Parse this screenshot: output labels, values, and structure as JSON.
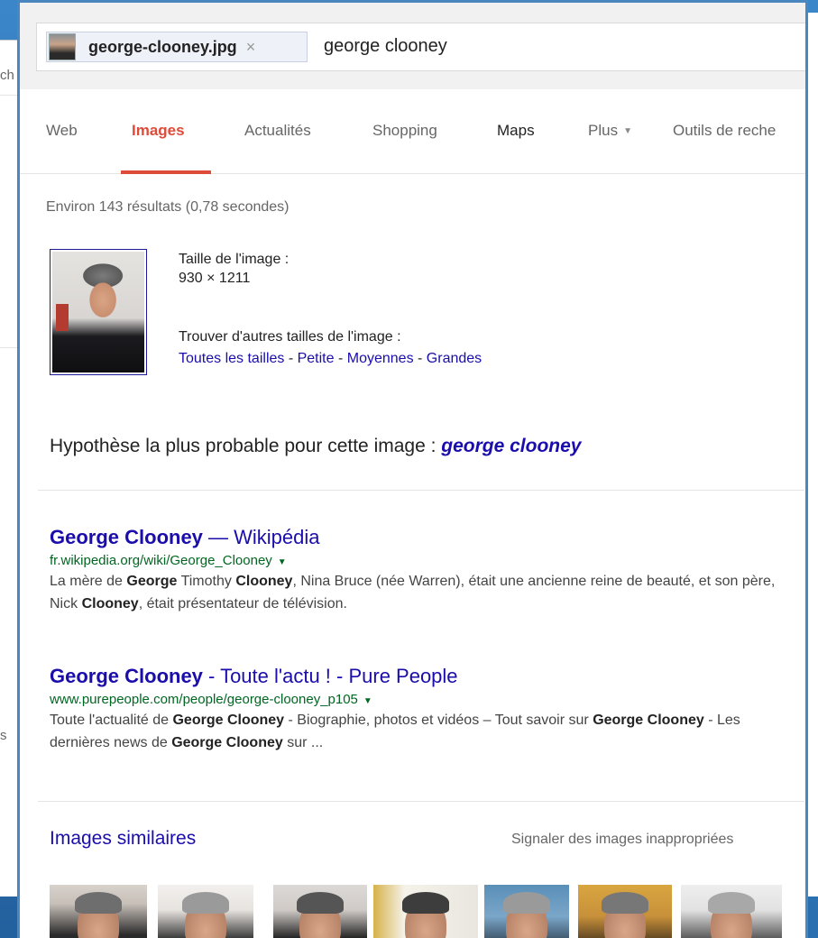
{
  "background": {
    "left_peek_top": "ch",
    "left_peek_mid": "s"
  },
  "search": {
    "chip_filename": "george-clooney.jpg",
    "chip_close": "×",
    "query": "george clooney"
  },
  "tabs": [
    {
      "label": "Web"
    },
    {
      "label": "Images"
    },
    {
      "label": "Actualités"
    },
    {
      "label": "Shopping"
    },
    {
      "label": "Maps"
    },
    {
      "label": "Plus"
    },
    {
      "label": "Outils de reche"
    }
  ],
  "stats": "Environ 143 résultats (0,78 secondes)",
  "image_info": {
    "size_label": "Taille de l'image :",
    "size_value": "930 × 1211",
    "other_sizes_label": "Trouver d'autres tailles de l'image :",
    "sizes": [
      "Toutes les tailles",
      "Petite",
      "Moyennes",
      "Grandes"
    ],
    "separator": " - "
  },
  "best_guess": {
    "label": "Hypothèse la plus probable pour cette image : ",
    "term": "george clooney"
  },
  "results": [
    {
      "title_bold": "George Clooney",
      "title_rest": " — Wikipédia",
      "url": "fr.wikipedia.org/wiki/George_Clooney",
      "snippet_parts": [
        {
          "t": "La mère de ",
          "b": false
        },
        {
          "t": "George",
          "b": true
        },
        {
          "t": " Timothy ",
          "b": false
        },
        {
          "t": "Clooney",
          "b": true
        },
        {
          "t": ", Nina Bruce (née Warren), était une ancienne reine de beauté, et son père, Nick ",
          "b": false
        },
        {
          "t": "Clooney",
          "b": true
        },
        {
          "t": ", était présentateur de télévision.",
          "b": false
        }
      ]
    },
    {
      "title_bold": "George Clooney",
      "title_rest": " - Toute l'actu ! - Pure People",
      "url": "www.purepeople.com/people/george-clooney_p105",
      "snippet_parts": [
        {
          "t": "Toute l'actualité de ",
          "b": false
        },
        {
          "t": "George Clooney",
          "b": true
        },
        {
          "t": " - Biographie, photos et vidéos – Tout savoir sur ",
          "b": false
        },
        {
          "t": "George Clooney",
          "b": true
        },
        {
          "t": " - Les dernières news de ",
          "b": false
        },
        {
          "t": "George Clooney",
          "b": true
        },
        {
          "t": " sur ...",
          "b": false
        }
      ]
    }
  ],
  "similar": {
    "title": "Images similaires",
    "report": "Signaler des images inappropriées",
    "thumb_count": 7
  },
  "colors": {
    "accent_red": "#dd4b39",
    "link_blue": "#1a0dab",
    "url_green": "#006621",
    "frame_blue": "#4a86c0"
  }
}
